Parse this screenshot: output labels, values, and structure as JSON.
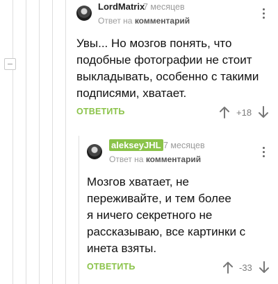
{
  "comments": [
    {
      "author": "LordMatrix",
      "time": "7 месяцев",
      "reply_prefix": "Ответ на",
      "reply_target": "комментарий",
      "text_lines": [
        "Увы... Но мозгов понять, что",
        "подобные фотографии не стоит",
        "выкладывать, особенно с такими",
        "подписями, хватает."
      ],
      "reply_label": "ОТВЕТИТЬ",
      "score": "+18"
    },
    {
      "author": "alekseyJHL",
      "time": "7 месяцев",
      "reply_prefix": "Ответ на",
      "reply_target": "комментарий",
      "text_lines": [
        "Мозгов хватает, не",
        "переживайте, и тем более",
        "я ничего секретного не",
        "рассказываю, все картинки с",
        "инета взяты."
      ],
      "reply_label": "ОТВЕТИТЬ",
      "score": "-33"
    }
  ],
  "colors": {
    "accent": "#8bc34a",
    "muted": "#9b9b9b",
    "thread_line": "#dedede"
  },
  "icons": [
    "avatar",
    "more-vertical-icon",
    "arrow-up-icon",
    "arrow-down-icon",
    "collapse-minus-icon"
  ]
}
